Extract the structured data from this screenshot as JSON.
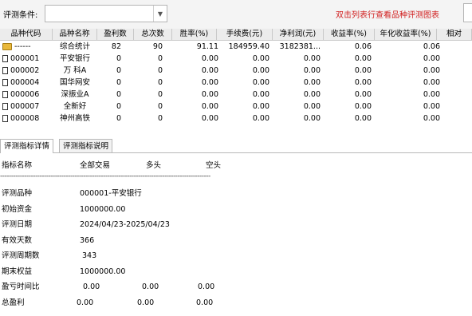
{
  "toolbar": {
    "condition_label": "评测条件:",
    "condition_value": "",
    "hint": "双击列表行查看品种评测图表"
  },
  "table": {
    "columns": [
      "品种代码",
      "品种名称",
      "盈利数",
      "总次数",
      "胜率(%)",
      "手续费(元)",
      "净利润(元)",
      "收益率(%)",
      "年化收益率(%)",
      "相对"
    ],
    "rows": [
      {
        "code": "------",
        "name": "综合统计",
        "profit": "82",
        "total": "90",
        "win": "91.11",
        "fee": "184959.40",
        "net": "3182381...",
        "ret": "0.06",
        "annual": "0.06",
        "icon": "folder-icon"
      },
      {
        "code": "000001",
        "name": "平安银行",
        "profit": "0",
        "total": "0",
        "win": "0.00",
        "fee": "0.00",
        "net": "0.00",
        "ret": "0.00",
        "annual": "0.00",
        "icon": "document-icon"
      },
      {
        "code": "000002",
        "name": "万 科A",
        "profit": "0",
        "total": "0",
        "win": "0.00",
        "fee": "0.00",
        "net": "0.00",
        "ret": "0.00",
        "annual": "0.00",
        "icon": "document-icon"
      },
      {
        "code": "000004",
        "name": "国华网安",
        "profit": "0",
        "total": "0",
        "win": "0.00",
        "fee": "0.00",
        "net": "0.00",
        "ret": "0.00",
        "annual": "0.00",
        "icon": "document-icon"
      },
      {
        "code": "000006",
        "name": "深振业A",
        "profit": "0",
        "total": "0",
        "win": "0.00",
        "fee": "0.00",
        "net": "0.00",
        "ret": "0.00",
        "annual": "0.00",
        "icon": "document-icon"
      },
      {
        "code": "000007",
        "name": "全新好",
        "profit": "0",
        "total": "0",
        "win": "0.00",
        "fee": "0.00",
        "net": "0.00",
        "ret": "0.00",
        "annual": "0.00",
        "icon": "document-icon"
      },
      {
        "code": "000008",
        "name": "神州高铁",
        "profit": "0",
        "total": "0",
        "win": "0.00",
        "fee": "0.00",
        "net": "0.00",
        "ret": "0.00",
        "annual": "0.00",
        "icon": "document-icon"
      }
    ]
  },
  "tabs": [
    {
      "label": "评测指标详情",
      "active": true
    },
    {
      "label": "评测指标说明",
      "active": false
    }
  ],
  "report": {
    "headers": [
      "指标名称",
      "全部交易",
      "多头",
      "空头"
    ],
    "dashes": "------------------------------------------------------------------------------------------------",
    "rows": [
      {
        "label": "评测品种",
        "values": [
          "000001-平安银行"
        ]
      },
      {
        "label": "初始资金",
        "values": [
          "1000000.00"
        ]
      },
      {
        "label": "评测日期",
        "values": [
          "2024/04/23-2025/04/23"
        ]
      },
      {
        "label": "有效天数",
        "values": [
          "366"
        ]
      },
      {
        "label": "评测周期数",
        "values": [
          "343"
        ]
      },
      {
        "label": "期末权益",
        "values": [
          "1000000.00"
        ]
      },
      {
        "label": "盈亏时间比",
        "values": [
          "0.00",
          "0.00",
          "0.00"
        ]
      },
      {
        "label": "总盈利",
        "values": [
          "0.00",
          "0.00",
          "0.00"
        ]
      }
    ]
  }
}
